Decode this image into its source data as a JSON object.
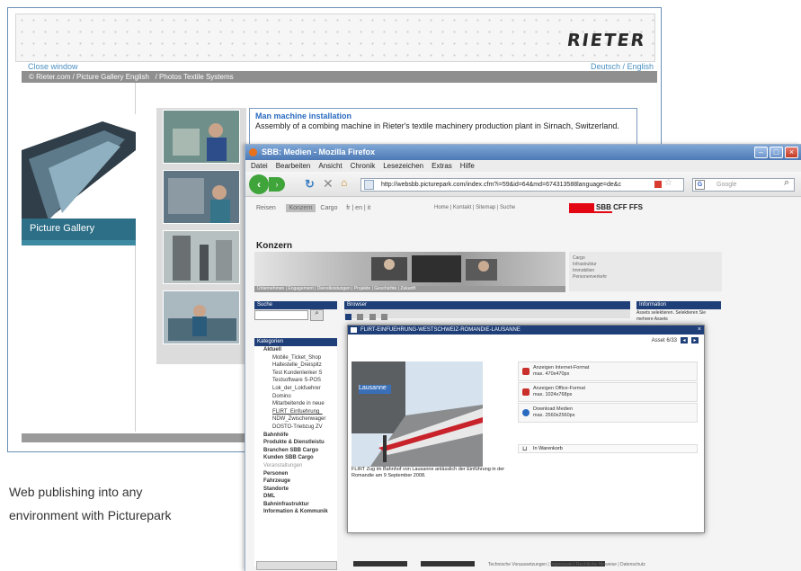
{
  "rieter": {
    "logo": "RIETER",
    "close_window": "Close window",
    "languages": "Deutsch / English",
    "breadcrumb": "© Rieter.com / Picture Gallery English   / Photos Textile Systems",
    "gallery_label": "Picture Gallery",
    "caption_title": "Man machine installation",
    "caption_text": "Assembly of a combing machine in Rieter's textile machinery production plant in Sirnach, Switzerland."
  },
  "firefox": {
    "title": "SBB: Medien - Mozilla Firefox",
    "menu": [
      "Datei",
      "Bearbeiten",
      "Ansicht",
      "Chronik",
      "Lesezeichen",
      "Extras",
      "Hilfe"
    ],
    "url": "http://websbb.picturepark.com/index.cfm?i=59&id=64&md=674313588language=de&c",
    "search_placeholder": "Google"
  },
  "sbb": {
    "nav": [
      "Reisen",
      "Konzern",
      "Cargo"
    ],
    "lang": "fr | en | it",
    "links": "Home | Kontakt | Sitemap | Suche",
    "logo": "SBB CFF FFS",
    "page_title": "Konzern",
    "side_links": [
      "Cargo",
      "Infrastruktur",
      "Immobilien",
      "Personenverkehr"
    ],
    "subnav": "Unternehmen | Engagement | Dienstleistungen | Projekte | Geschichte | Zukunft",
    "search_head": "Suche",
    "categories_head": "Kategorien",
    "categories": [
      {
        "label": "Aktuell",
        "level": 1
      },
      {
        "label": "Mobile_Ticket_Shop",
        "level": 2
      },
      {
        "label": "Haltestelle_Dreispitz",
        "level": 2
      },
      {
        "label": "Test Kundenlenker S",
        "level": 2
      },
      {
        "label": "Testsoftware S-POS",
        "level": 2
      },
      {
        "label": "Lok_der_Lokfuehrer",
        "level": 2
      },
      {
        "label": "Domino",
        "level": 2
      },
      {
        "label": "Mitarbeitende in neue",
        "level": 2
      },
      {
        "label": "FLIRT_Einfuehrung_",
        "level": 2,
        "underline": true
      },
      {
        "label": "NDW_Zwischenwager",
        "level": 2
      },
      {
        "label": "DOSTO-Triebzug ZV",
        "level": 2
      },
      {
        "label": "Bahnhöfe",
        "level": 1
      },
      {
        "label": "Produkte & Dienstleistu",
        "level": 1
      },
      {
        "label": "Branchen SBB Cargo",
        "level": 1
      },
      {
        "label": "Kunden SBB Cargo",
        "level": 1
      },
      {
        "label": "Veranstaltungen",
        "level": 1,
        "muted": true
      },
      {
        "label": "Personen",
        "level": 1
      },
      {
        "label": "Fahrzeuge",
        "level": 1
      },
      {
        "label": "Standorte",
        "level": 1
      },
      {
        "label": "DML",
        "level": 1
      },
      {
        "label": "Bahninfrastruktur",
        "level": 1
      },
      {
        "label": "Information & Kommunik",
        "level": 1
      }
    ],
    "browser_head": "Browser",
    "info_head": "Information",
    "info_text": "Assets selektieren. Selektieren Sie mehrere Assets",
    "footer": "Technische Voraussetzungen  |  Impressum  |  Rechtliche Hinweise  |  Datenschutz"
  },
  "lightbox": {
    "title": "FLIRT-EINFUEHRUNG-WESTSCHWEIZ-ROMANDIE-LAUSANNE",
    "counter": "Asset 6/33",
    "sign": "Lausanne",
    "caption": "FLIRT Zug im Bahnhof von Lausanne anlässlich der Einführung in der Romandie am 9 September 2008.",
    "options": [
      {
        "title": "Anzeigen Internet-Format",
        "detail": "max. 470x470px"
      },
      {
        "title": "Anzeigen Office-Format",
        "detail": "max. 1024x768px"
      },
      {
        "title": "Download Medien",
        "detail": "max. 2560x2560px"
      }
    ],
    "cart": "In Warenkorb"
  },
  "caption": {
    "line1": "Web publishing into any",
    "line2": "environment  with Picturepark"
  }
}
